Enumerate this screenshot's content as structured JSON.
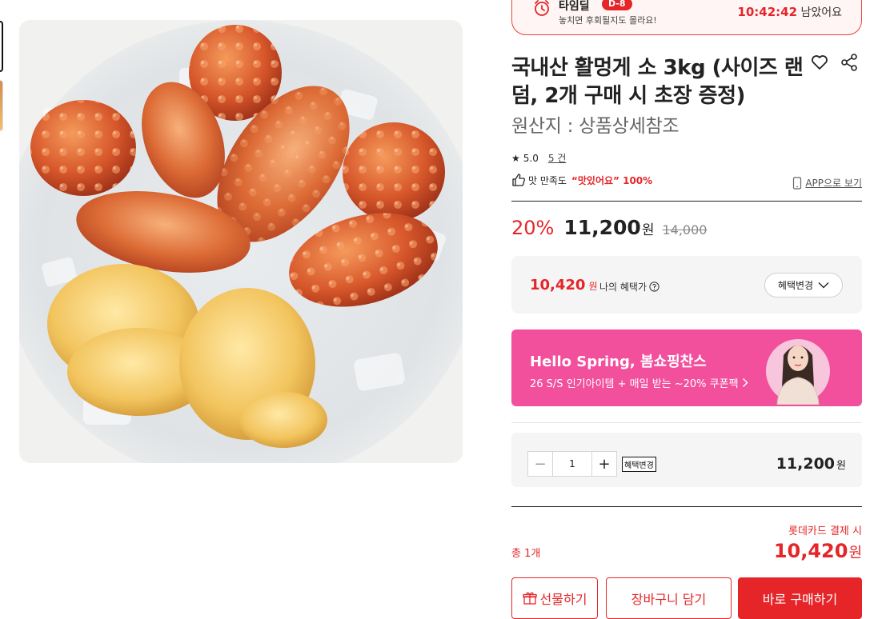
{
  "timedeal": {
    "title": "타임딜",
    "badge": "D-8",
    "subtitle": "놓치면 후회될지도 몰라요!",
    "timer": "10:42:42",
    "timer_suffix": "남았어요"
  },
  "product": {
    "title": "국내산 활멍게 소 3kg (사이즈 랜덤, 2개 구매 시 초장 증정)",
    "origin": "원산지 : 상품상세참조"
  },
  "rating": {
    "score": "5.0",
    "count": "5 건"
  },
  "satisfaction": {
    "prefix": "맛 만족도",
    "highlight": "“맛있어요” 100%"
  },
  "app_view_label": "APP으로 보기",
  "price": {
    "discount": "20%",
    "sale": "11,200",
    "unit": "원",
    "original": "14,000"
  },
  "benefit": {
    "price": "10,420",
    "unit": "원",
    "label": "나의 혜택가",
    "button": "혜택변경"
  },
  "banner": {
    "title": "Hello Spring, 봄쇼핑찬스",
    "subtitle": "26 S/S 인기아이템 + 매일 받는 ~20% 쿠폰팩"
  },
  "quantity": {
    "minus": "−",
    "value": "1",
    "plus": "+",
    "benefit_button": "혜택변경",
    "price": "11,200",
    "unit": "원"
  },
  "summary": {
    "total_label": "총 1개",
    "card_label": "롯데카드 결제 시",
    "total_price": "10,420",
    "unit": "원"
  },
  "actions": {
    "gift": "선물하기",
    "cart": "장바구니 담기",
    "buy": "바로 구매하기"
  },
  "colors": {
    "accent": "#e52528",
    "banner": "#f24f9c"
  }
}
